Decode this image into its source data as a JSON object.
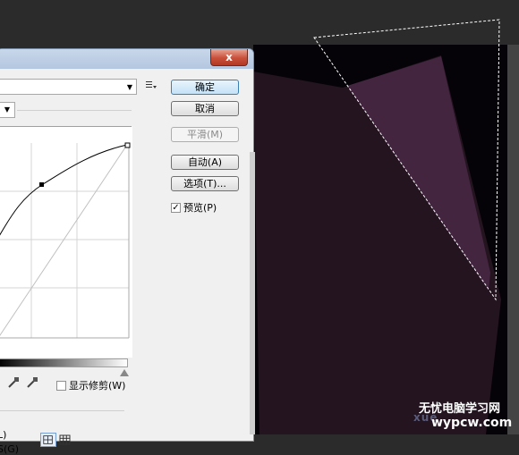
{
  "dialog": {
    "close_label": "x",
    "preset_arrow": "▼",
    "channel_arrow": "▼",
    "buttons": {
      "ok": "确定",
      "cancel": "取消",
      "smooth": "平滑(M)",
      "auto": "自动(A)",
      "options": "选项(T)..."
    },
    "preview_label": "预览(P)",
    "preview_checked": "✓",
    "show_clipping_label": "显示修剪(W)",
    "partial_label_l": "L)",
    "partial_label_g": "S(G)"
  },
  "watermark": {
    "line1": "无忧电脑学习网",
    "line2": "xue",
    "line3": "wypcw.com"
  },
  "colors": {
    "canvas_bg": "#050307",
    "shape_dark": "#23141f",
    "shape_light": "#432540"
  }
}
